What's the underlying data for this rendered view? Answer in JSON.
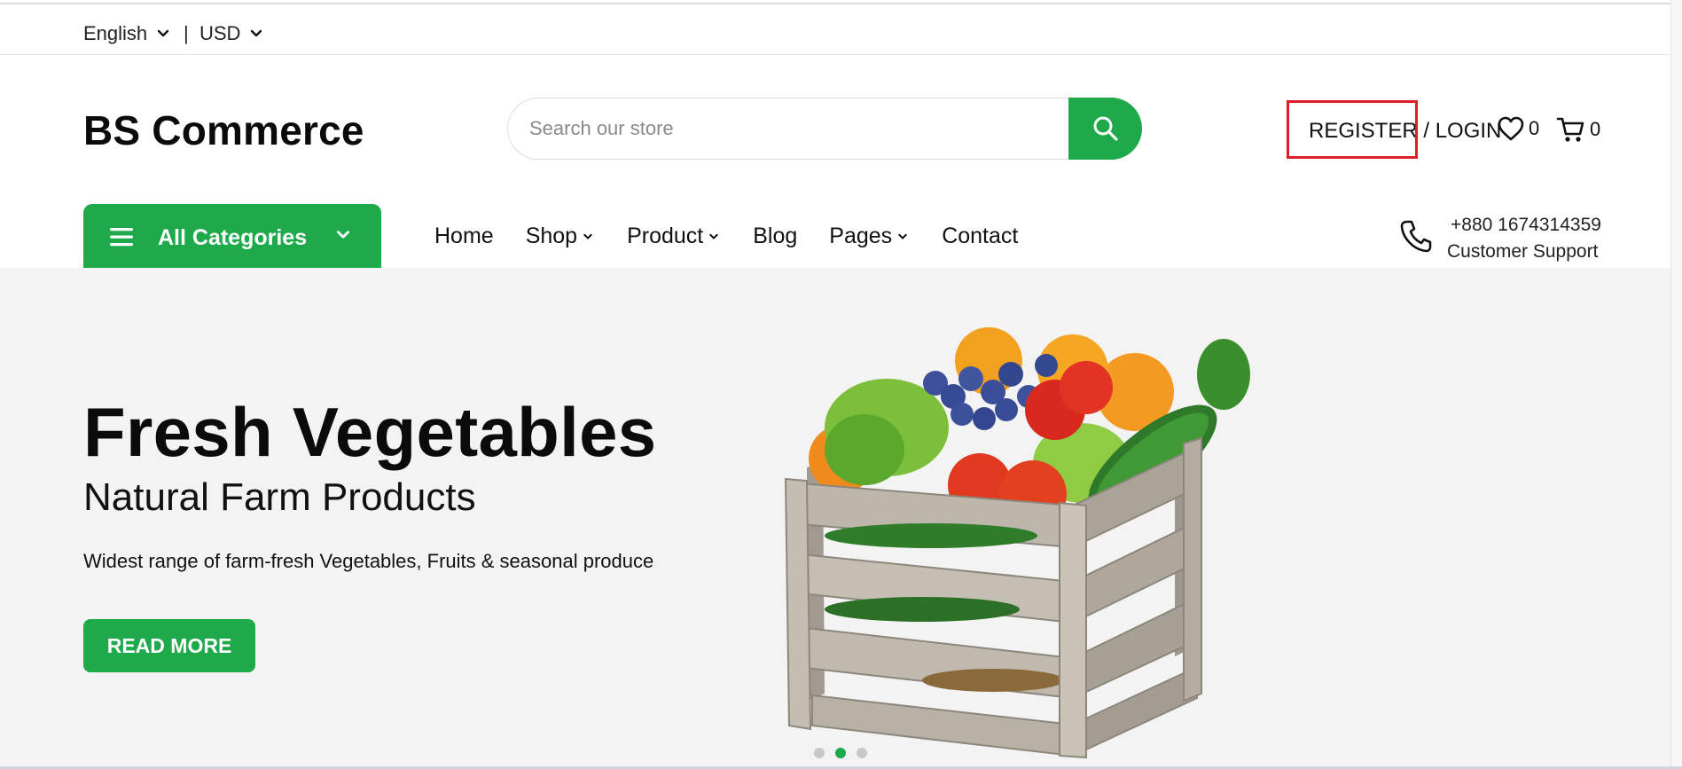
{
  "topbar": {
    "language": "English",
    "separator": "|",
    "currency": "USD"
  },
  "header": {
    "logo": "BS Commerce",
    "search_placeholder": "Search our store",
    "account_label": "REGISTER / LOGIN",
    "wishlist_count": "0",
    "cart_count": "0"
  },
  "nav": {
    "categories_label": "All Categories",
    "items": [
      "Home",
      "Shop",
      "Product",
      "Blog",
      "Pages",
      "Contact"
    ]
  },
  "support": {
    "phone": "+880 1674314359",
    "label": "Customer Support"
  },
  "hero": {
    "title": "Fresh Vegetables",
    "subtitle": "Natural Farm Products",
    "description": "Widest range of farm-fresh Vegetables, Fruits & seasonal produce",
    "button": "READ MORE",
    "slides_total": 3,
    "active_slide": 2
  },
  "colors": {
    "brand_green": "#1ea94a",
    "highlight_red": "#e01e26",
    "hero_bg": "#f3f3f3"
  },
  "icons": [
    "chevron-down-icon",
    "search-icon",
    "heart-icon",
    "cart-icon",
    "menu-icon",
    "phone-icon"
  ]
}
